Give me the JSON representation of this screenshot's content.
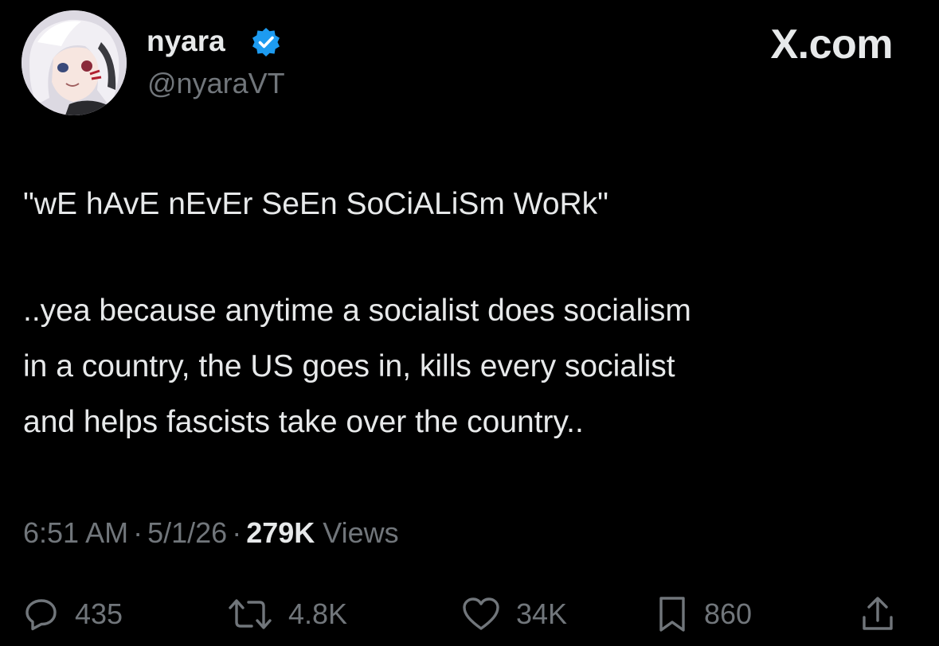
{
  "header": {
    "display_name": "nyara",
    "handle": "@nyaraVT",
    "site_label": "X.com",
    "verified_color": "#1d9bf0",
    "avatar_icon": "anime-avatar-icon"
  },
  "tweet": {
    "line1": "\"wE hAvE nEvEr SeEn SoCiALiSm WoRk\"",
    "para2": "..yea because anytime a socialist does socialism\nin a country, the US goes in, kills every socialist\nand helps fascists take over the country.."
  },
  "meta": {
    "time": "6:51 AM",
    "separator": "·",
    "date": "5/1/26",
    "views_count": "279K",
    "views_label": "Views"
  },
  "actions": {
    "replies": "435",
    "reposts": "4.8K",
    "likes": "34K",
    "bookmarks": "860"
  },
  "colors": {
    "background": "#000000",
    "primary_text": "#e7e9ea",
    "secondary_text": "#71767b"
  }
}
